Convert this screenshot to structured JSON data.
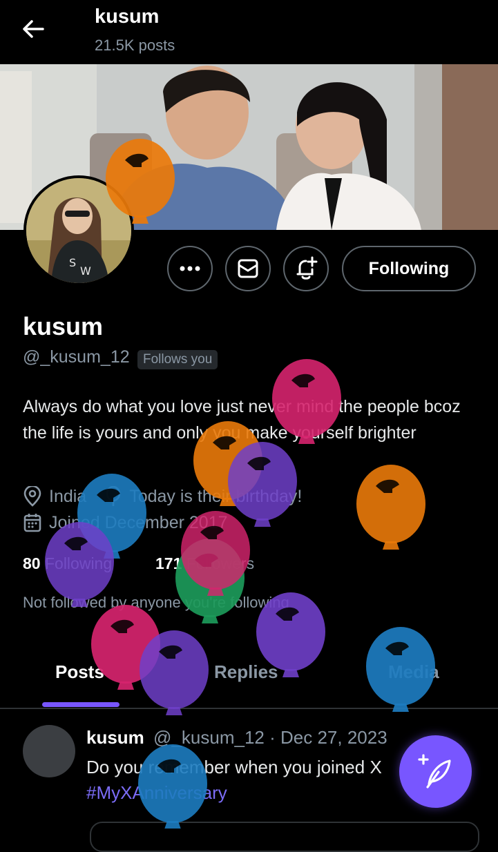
{
  "header": {
    "name": "kusum",
    "posts_count": "21.5K posts"
  },
  "actions": {
    "following_label": "Following"
  },
  "profile": {
    "display_name": "kusum",
    "handle": "@_kusum_12",
    "follows_you": "Follows you",
    "bio": "Always do what you love just never mind the people bcoz the life is yours and only you make yourself brighter",
    "location": "India",
    "birthday": "Today is their birthday!",
    "joined": "Joined December 2017",
    "following_count": "80",
    "following_label": "Following",
    "followers_count": "171",
    "followers_label": "Followers",
    "not_followed": "Not followed by anyone you're following"
  },
  "tabs": [
    {
      "label": "Posts",
      "active": true
    },
    {
      "label": "Replies",
      "active": false
    },
    {
      "label": "Media",
      "active": false
    }
  ],
  "post": {
    "name": "kusum",
    "handle": "@_kusum_12",
    "separator": "·",
    "date": "Dec 27, 2023",
    "text": "Do you remember when you joined X",
    "hashtag": "#MyXAnniversary"
  },
  "icons": {
    "back": "back-arrow-icon",
    "more": "more-dots-icon",
    "message": "mail-icon",
    "notify": "bell-plus-icon",
    "location": "location-pin-icon",
    "birthday": "balloon-icon",
    "calendar": "calendar-icon",
    "compose": "feather-plus-icon"
  },
  "colors": {
    "accent": "#7856ff",
    "hashtag": "#7b6cf6",
    "muted": "#8b98a5",
    "balloon_pink": "#d6246e",
    "balloon_orange": "#ea7a0a",
    "balloon_purple": "#6f3fc9",
    "balloon_blue": "#1d7cc0",
    "balloon_green": "#1c9a5a"
  }
}
